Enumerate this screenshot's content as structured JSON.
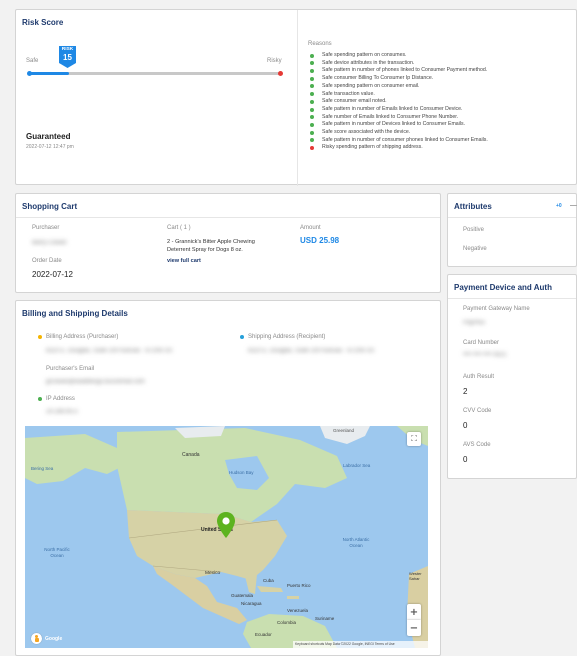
{
  "risk": {
    "title": "Risk Score",
    "safe_label": "Safe",
    "risky_label": "Risky",
    "badge_label": "RISK",
    "score": 15,
    "status": "Guaranteed",
    "timestamp": "2022-07-12 12:47 pm",
    "reasons_label": "Reasons",
    "reasons": [
      {
        "text": "Safe spending pattern on consumes.",
        "type": "safe"
      },
      {
        "text": "Safe device attributes in the transaction.",
        "type": "safe"
      },
      {
        "text": "Safe pattern in number of phones linked to Consumer Payment method.",
        "type": "safe"
      },
      {
        "text": "Safe consumer Billing To Consumer Ip Distance.",
        "type": "safe"
      },
      {
        "text": "Safe spending pattern on consumer email.",
        "type": "safe"
      },
      {
        "text": "Safe transaction value.",
        "type": "safe"
      },
      {
        "text": "Safe consumer email noted.",
        "type": "safe"
      },
      {
        "text": "Safe pattern in number of Emails linked to Consumer Device.",
        "type": "safe"
      },
      {
        "text": "Safe number of Emails linked to Consumer Phone Number.",
        "type": "safe"
      },
      {
        "text": "Safe pattern in number of Devices linked to Consumer Emails.",
        "type": "safe"
      },
      {
        "text": "Safe score associated with the device.",
        "type": "safe"
      },
      {
        "text": "Safe pattern in number of consumer phones linked to Consumer Emails.",
        "type": "safe"
      },
      {
        "text": "Risky spending pattern of shipping address.",
        "type": "risky"
      }
    ]
  },
  "cart": {
    "title": "Shopping Cart",
    "purchaser_label": "Purchaser",
    "purchaser_value": "Barry Cowan",
    "cart_label": "Cart ( 1 )",
    "item_line1": "2 - Grannick's Bitter Apple Chewing",
    "item_line2": "Deterrent Spray for Dogs 8 oz.",
    "view_link": "view full cart",
    "amount_label": "Amount",
    "amount_value": "USD 25.98",
    "order_date_label": "Order Date",
    "order_date_value": "2022-07-12"
  },
  "billing": {
    "title": "Billing and Shipping Details",
    "billing_label": "Billing Address (Purchaser)",
    "billing_value": "8110 E. Douglas, Suite 100 Kansas - 67206 US",
    "shipping_label": "Shipping Address (Recipient)",
    "shipping_value": "8110 E. Douglas, Suite 100 Kansas - 67206 US",
    "email_label": "Purchaser's Email",
    "email_value": "grcowan@waddlesgs.buzzemail.com",
    "ip_label": "IP Address",
    "ip_value": "24.168.95.5"
  },
  "map": {
    "labels": {
      "greenland": "Greenland",
      "canada": "Canada",
      "bering_sea": "Bering Sea",
      "hudson_bay": "Hudson Bay",
      "labrador_sea": "Labrador Sea",
      "united_states": "United States",
      "north_pacific": "North Pacific Ocean",
      "north_atlantic": "North Atlantic Ocean",
      "mexico": "Mexico",
      "cuba": "Cuba",
      "puerto_rico": "Puerto Rico",
      "guatemala": "Guatemala",
      "nicaragua": "Nicaragua",
      "venezuela": "Venezuela",
      "colombia": "Colombia",
      "suriname": "Suriname",
      "ecuador": "Ecuador",
      "western_sahara": "Wester Sahar",
      "google": "Google"
    },
    "attribution": "Keyboard shortcuts  Map Data ©2022 Google, INEGI  Terms of Use",
    "zoom_in": "+",
    "zoom_out": "−",
    "fullscreen": "⛶"
  },
  "attributes": {
    "title": "Attributes",
    "count_text": "+0",
    "positive_label": "Positive",
    "negative_label": "Negative"
  },
  "payment": {
    "title": "Payment Device and Auth",
    "gateway_label": "Payment Gateway Name",
    "gateway_value": "PayPlus",
    "card_label": "Card Number",
    "card_value": "•••• •••• •••• 4321",
    "auth_label": "Auth Result",
    "auth_value": "2",
    "cvv_label": "CVV Code",
    "cvv_value": "0",
    "avs_label": "AVS Code",
    "avs_value": "0"
  },
  "colors": {
    "accent": "#1e88e5",
    "title_blue": "#1e3a6d",
    "safe_green": "#4caf50",
    "risky_red": "#e53935",
    "pin_green": "#5db31f",
    "billing_dot": "#f5b400",
    "shipping_dot": "#26a0da"
  }
}
